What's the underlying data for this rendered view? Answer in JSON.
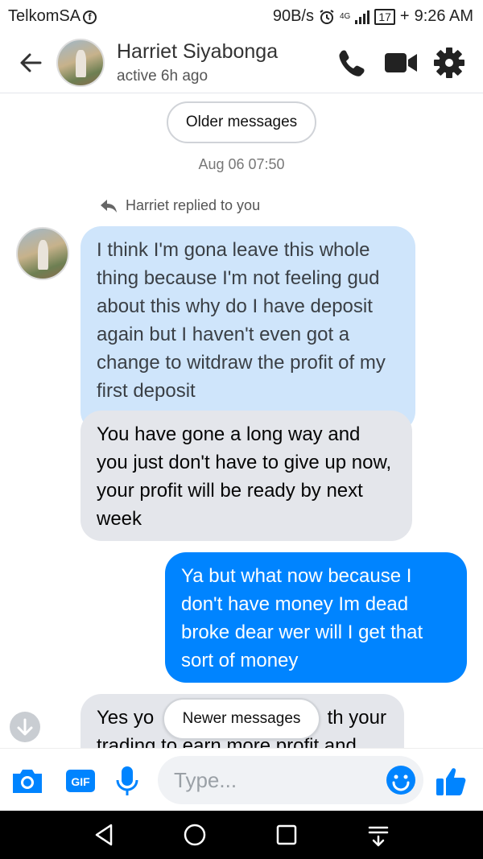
{
  "status_bar": {
    "carrier": "TelkomSA",
    "carrier_icon": "f",
    "speed": "90B/s",
    "network": "4G",
    "battery": "17",
    "charging": "+",
    "time": "9:26 AM"
  },
  "header": {
    "name": "Harriet Siyabonga",
    "status": "active 6h ago",
    "icons": [
      "back-arrow-icon",
      "phone-icon",
      "video-camera-icon",
      "gear-icon"
    ]
  },
  "thread": {
    "older_label": "Older messages",
    "timestamp": "Aug 06 07:50",
    "reply_note": "Harriet replied to you",
    "messages": [
      {
        "from": "me",
        "quoted": true,
        "text": "I think I'm gona leave this whole thing because I'm not feeling gud about this why do I have deposit again but I haven't even got a change to witdraw the profit of my first deposit"
      },
      {
        "from": "Harriet Siyabonga",
        "text": "You have gone a long way and you just don't have to give up now, your profit will be ready by next week"
      },
      {
        "from": "me",
        "text": "Ya but what now because I don't have money Im dead broke dear wer will I get that sort of money"
      },
      {
        "from": "Harriet Siyabonga",
        "text_line1_left": "Yes yo",
        "text_line1_right": "th your",
        "text_line2": "trading to earn more profit and"
      }
    ],
    "newer_label": "Newer messages"
  },
  "composer": {
    "placeholder": "Type...",
    "gif_label": "GIF",
    "icons": [
      "camera-icon",
      "gif-icon",
      "microphone-icon",
      "emoji-icon",
      "thumbs-up-icon"
    ]
  },
  "colors": {
    "messenger_blue": "#0084ff",
    "quoted_bubble": "#cfe5fb",
    "received_bubble": "#e4e6eb"
  }
}
